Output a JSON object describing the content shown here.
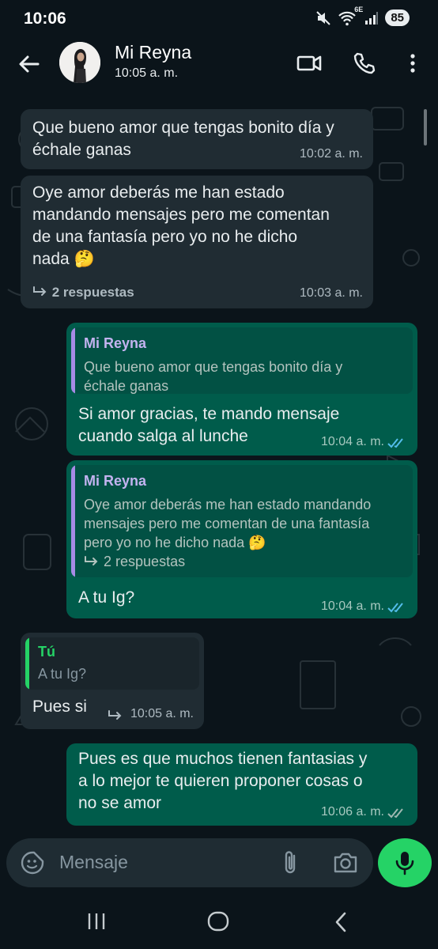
{
  "status_bar": {
    "time": "10:06",
    "battery": "85",
    "network": "6E"
  },
  "header": {
    "contact_name": "Mi Reyna",
    "subtitle": "10:05 a. m."
  },
  "messages": [
    {
      "direction": "incoming",
      "text_lines": [
        "Que bueno amor que tengas bonito día y",
        "échale ganas"
      ],
      "time": "10:02 a. m."
    },
    {
      "direction": "incoming",
      "text_lines": [
        "Oye amor deberás me han estado",
        "mandando mensajes pero me comentan",
        "de una fantasía pero yo no he dicho",
        "nada 🤔"
      ],
      "replies": "2 respuestas",
      "time": "10:03 a. m."
    },
    {
      "direction": "outgoing",
      "quote": {
        "name": "Mi Reyna",
        "text_lines": [
          "Que bueno amor que tengas bonito día y",
          "échale ganas"
        ]
      },
      "text_lines": [
        "Si amor gracias, te mando mensaje",
        "cuando salga al lunche"
      ],
      "time": "10:04 a. m.",
      "status": "read"
    },
    {
      "direction": "outgoing",
      "quote": {
        "name": "Mi Reyna",
        "text_lines": [
          "Oye amor deberás me han estado mandando",
          "mensajes pero me comentan de una fantasía",
          "pero yo no he dicho nada 🤔"
        ],
        "replies": "2 respuestas"
      },
      "text_lines": [
        "A tu Ig?"
      ],
      "time": "10:04 a. m.",
      "status": "read"
    },
    {
      "direction": "incoming",
      "quote": {
        "name": "Tú",
        "text_lines": [
          "A tu Ig?"
        ]
      },
      "text_lines": [
        "Pues si"
      ],
      "time": "10:05 a. m."
    },
    {
      "direction": "outgoing",
      "text_lines": [
        "Pues es que muchos tienen fantasias y",
        "a lo mejor te quieren proponer cosas o",
        "no se amor"
      ],
      "time": "10:06 a. m.",
      "status": "delivered"
    }
  ],
  "composer": {
    "placeholder": "Mensaje"
  },
  "colors": {
    "background": "#0b141a",
    "incoming_bubble": "#202c33",
    "outgoing_bubble": "#005c4b",
    "accent_green": "#25d366",
    "read_ticks": "#53bdeb",
    "quote_purple": "#a78be6"
  },
  "icons": [
    "back-arrow-icon",
    "video-call-icon",
    "phone-icon",
    "more-options-icon",
    "sticker-icon",
    "attach-icon",
    "camera-icon",
    "mic-icon",
    "reply-arrow-icon",
    "double-check-icon"
  ]
}
